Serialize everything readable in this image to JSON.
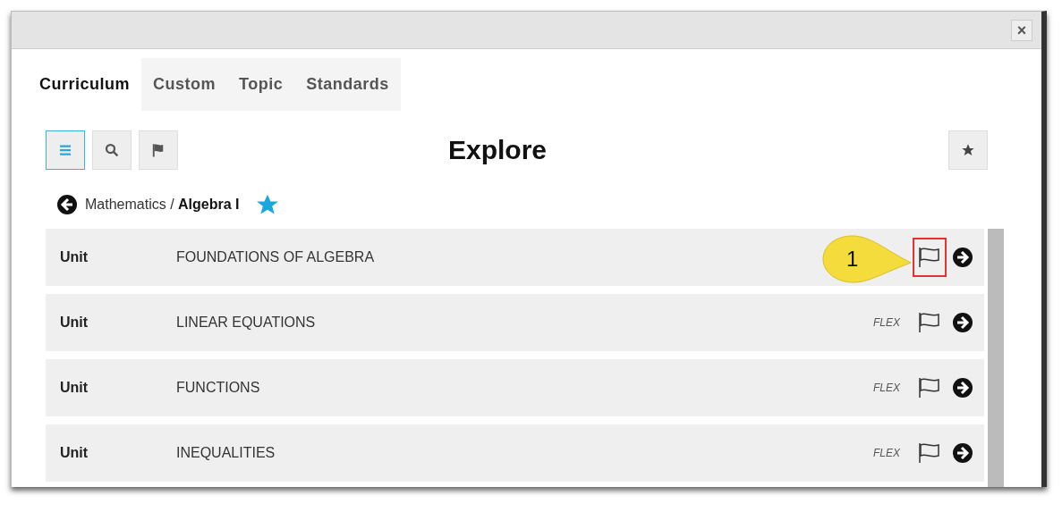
{
  "window": {
    "close": "×"
  },
  "tabs": [
    {
      "label": "Curriculum",
      "selected": true
    },
    {
      "label": "Custom",
      "selected": false
    },
    {
      "label": "Topic",
      "selected": false
    },
    {
      "label": "Standards",
      "selected": false
    }
  ],
  "view_buttons": [
    {
      "kind": "list",
      "selected": true
    },
    {
      "kind": "search",
      "selected": false
    },
    {
      "kind": "flag",
      "selected": false
    }
  ],
  "heading": "Explore",
  "breadcrumb": {
    "parent": "Mathematics",
    "separator": "/",
    "current": "Algebra I",
    "favorite": true
  },
  "rows": [
    {
      "type": "Unit",
      "title": "FOUNDATIONS OF ALGEBRA",
      "highlighted": true
    },
    {
      "type": "Unit",
      "title": "LINEAR EQUATIONS",
      "flex": "FLEX",
      "highlighted": false
    },
    {
      "type": "Unit",
      "title": "FUNCTIONS",
      "flex": "FLEX",
      "highlighted": false
    },
    {
      "type": "Unit",
      "title": "INEQUALITIES",
      "flex": "FLEX",
      "highlighted": false
    }
  ],
  "callout": {
    "label": "1"
  }
}
